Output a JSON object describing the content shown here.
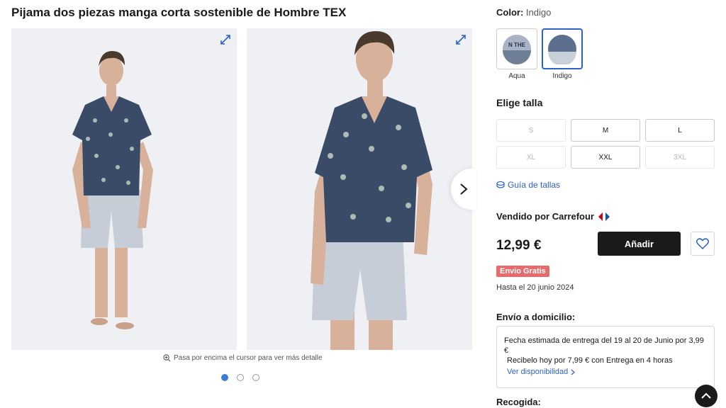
{
  "product": {
    "title": "Pijama dos piezas manga corta sostenible de Hombre TEX"
  },
  "gallery": {
    "zoom_hint": "Pasa por encima el cursor para ver más detalle",
    "images": [
      {
        "name": "photo-full-body",
        "icon": "expand-icon"
      },
      {
        "name": "photo-close-up",
        "icon": "expand-icon"
      }
    ],
    "dots": 3,
    "active_dot": 0
  },
  "color": {
    "label": "Color:",
    "value": "Indigo",
    "swatches": [
      {
        "label": "Aqua",
        "print_text": "N THE",
        "selected": false
      },
      {
        "label": "Indigo",
        "selected": true
      }
    ]
  },
  "sizes": {
    "title": "Elige talla",
    "options": [
      {
        "label": "S",
        "available": false
      },
      {
        "label": "M",
        "available": true
      },
      {
        "label": "L",
        "available": true
      },
      {
        "label": "XL",
        "available": false
      },
      {
        "label": "XXL",
        "available": true
      },
      {
        "label": "3XL",
        "available": false
      }
    ],
    "guide_label": "Guía de tallas"
  },
  "purchase": {
    "seller": "Vendido por Carrefour",
    "price": "12,99 €",
    "add_label": "Añadir",
    "badge": "Envio Gratis",
    "until": "Hasta el 20 junio 2024"
  },
  "shipping": {
    "title": "Envío a domicilio:",
    "estimate": "Fecha estimada de entrega del 19 al 20 de Junio por 3,99 €",
    "express": "Recibelo hoy por 7,99 € con Entrega en 4 horas",
    "availability": "Ver disponibilidad"
  },
  "pickup": {
    "title": "Recogida:"
  },
  "colors": {
    "accent": "#2c62c8",
    "badge": "#e86a6a",
    "dark": "#1a1a1a",
    "dot_active": "#3b7bd6"
  }
}
